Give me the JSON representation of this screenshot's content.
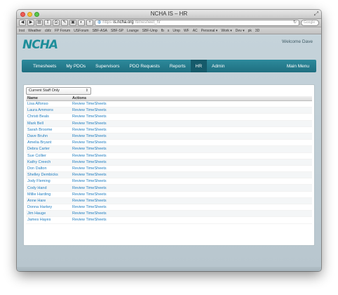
{
  "window": {
    "title": "NCHA IS – HR"
  },
  "browser": {
    "url_host": "is.ncha.org",
    "url_path": "/timesheet_hr",
    "url_scheme": "https",
    "search_placeholder": "Google",
    "bookmarks": [
      "Inst",
      "Weather",
      "cbfz",
      "FP Forum",
      "USForum",
      "SBF-ASA",
      "SBF-SP",
      "Lounge",
      "SBF-Ump",
      "fb",
      "s",
      "Ump",
      "WF",
      "AC",
      "Personal ▾",
      "Work ▾",
      "Dev ▾",
      "pk",
      "3D"
    ]
  },
  "site": {
    "logo_text": "NCHA",
    "welcome": "Welcome Dave",
    "brand_color": "#1f6f80"
  },
  "nav": {
    "items": [
      "Timesheets",
      "My PDOs",
      "Supervisors",
      "PDO Requests",
      "Reports",
      "HR",
      "Admin"
    ],
    "active": "HR",
    "main_menu": "Main Menu"
  },
  "filter": {
    "selected": "Current Staff Only"
  },
  "table": {
    "headers": [
      "Name",
      "Actions"
    ],
    "action_label": "Review TimeSheets",
    "rows": [
      "Lisa Alfonso",
      "Laura Ammons",
      "Christi Beals",
      "Mark Bell",
      "Sarah Broome",
      "Dave Bruhn",
      "Amelia Bryant",
      "Debra Carter",
      "Sue Collier",
      "Kathy Creech",
      "Don Dalton",
      "Shelley Dembicks",
      "Jody Fleming",
      "Cody Hand",
      "Millie Harding",
      "Anne Hare",
      "Donna Harkey",
      "Jim Hauge",
      "James Hayes"
    ]
  }
}
